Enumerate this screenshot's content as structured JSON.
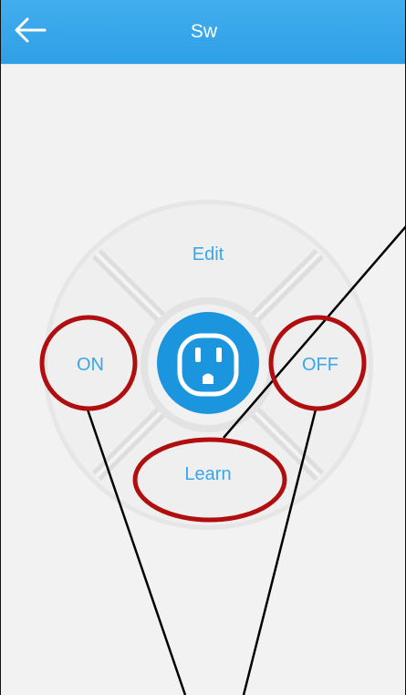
{
  "header": {
    "title": "Sw",
    "back_icon": "arrow-left-icon",
    "color": "#3aa8ec"
  },
  "remote": {
    "edit_label": "Edit",
    "on_label": "ON",
    "off_label": "OFF",
    "learn_label": "Learn",
    "center_icon": "power-outlet-icon",
    "accent_color": "#37a7ea"
  },
  "annotations": {
    "circle_color": "#b10f0f",
    "line_color": "#000000"
  }
}
